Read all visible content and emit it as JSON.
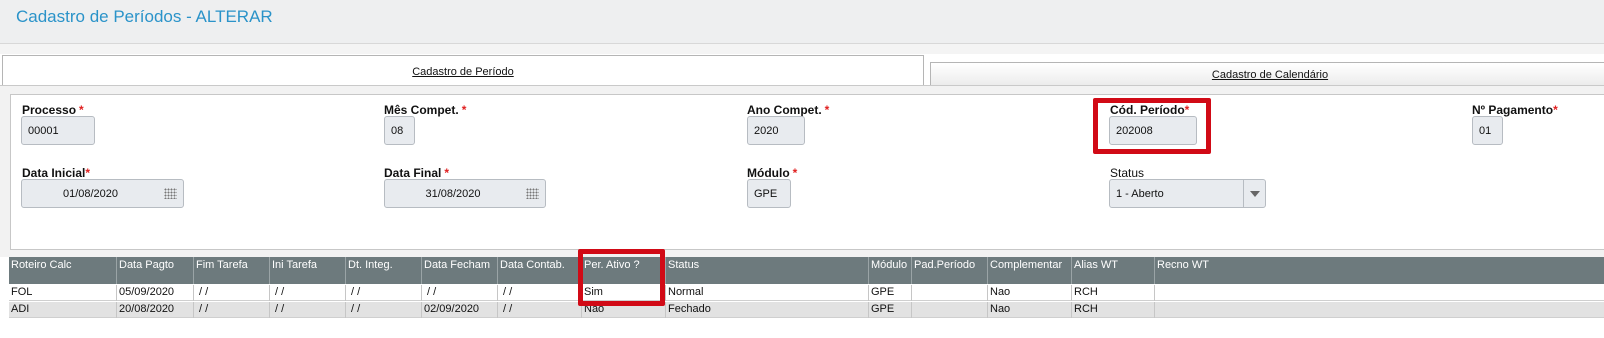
{
  "page": {
    "title": "Cadastro de Períodos - ALTERAR"
  },
  "tabs": [
    {
      "label": "Cadastro de Período",
      "active": true
    },
    {
      "label": "Cadastro de Calendário",
      "active": false
    }
  ],
  "form": {
    "processo": {
      "label": "Processo",
      "value": "00001",
      "required": "*"
    },
    "mes_compet": {
      "label": "Mês Compet.",
      "value": "08",
      "required": "*"
    },
    "ano_compet": {
      "label": "Ano Compet.",
      "value": "2020",
      "required": "*"
    },
    "cod_periodo": {
      "label": "Cód. Período",
      "value": "202008",
      "required": "*"
    },
    "n_pagamento": {
      "label": "Nº Pagamento",
      "value": "01",
      "required": "*"
    },
    "data_inicial": {
      "label": "Data Inicial",
      "value": "01/08/2020",
      "required": "*"
    },
    "data_final": {
      "label": "Data Final",
      "value": "31/08/2020",
      "required": "*"
    },
    "modulo": {
      "label": "Módulo",
      "value": "GPE",
      "required": "*"
    },
    "status": {
      "label": "Status",
      "value": "1 - Aberto"
    }
  },
  "grid": {
    "columns": [
      "Roteiro Calc",
      "Data Pagto",
      "Fim Tarefa",
      "Ini Tarefa",
      "Dt. Integ.",
      "Data Fecham",
      "Data Contab.",
      "Per. Ativo ?",
      "Status",
      "Módulo",
      "Pad.Período",
      "Complementar",
      "Alias WT",
      "Recno WT"
    ],
    "rows": [
      [
        "FOL",
        "05/09/2020",
        " / /",
        " / /",
        " / /",
        " / /",
        " / /",
        "Sim",
        "Normal",
        "GPE",
        "",
        "Nao",
        "RCH",
        ""
      ],
      [
        "ADI",
        "20/08/2020",
        " / /",
        " / /",
        " / /",
        "02/09/2020",
        " / /",
        "Nao",
        "Fechado",
        "GPE",
        "",
        "Nao",
        "RCH",
        ""
      ]
    ]
  },
  "colors": {
    "title": "#2a93c9",
    "grid_header": "#6d7a7d",
    "highlight": "#d10a16",
    "required": "#e02020"
  }
}
